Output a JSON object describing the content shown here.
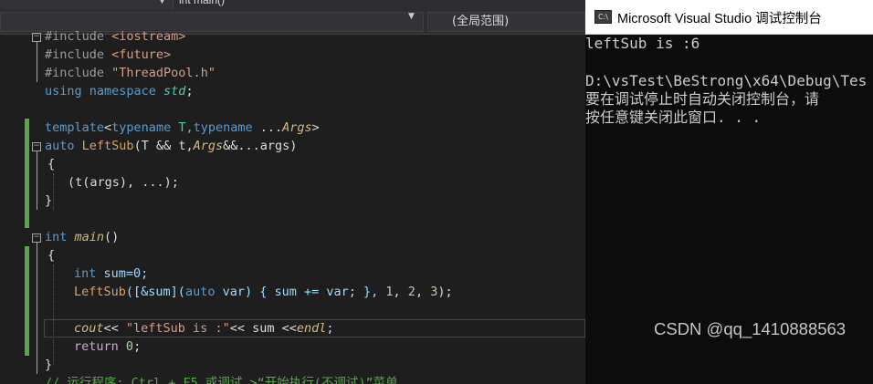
{
  "editor": {
    "top_dropdown": {
      "label": "int main()"
    },
    "scope_dropdown": {
      "label": "(全局范围)"
    },
    "lines": {
      "l1": {
        "a": "#include ",
        "b": "<iostream>"
      },
      "l2": {
        "a": "#include ",
        "b": "<future>"
      },
      "l3": {
        "a": "#include ",
        "b": "\"ThreadPool.h\""
      },
      "l4": {
        "a": "using",
        "b": " namespace ",
        "c": "std",
        "d": ";"
      },
      "l6": {
        "a": "template",
        "b": "<",
        "c": "typename",
        "d": " T,",
        "e": "typename",
        "f": " ...",
        "g": "Args",
        "h": ">"
      },
      "l7": {
        "a": "auto",
        "b": " ",
        "c": "LeftSub",
        "d": "(T && t,",
        "e": "Args",
        "f": "&&...args)"
      },
      "l8": {
        "a": "{"
      },
      "l9": {
        "a": "(t(args), ...);"
      },
      "l10": {
        "a": "}"
      },
      "l12": {
        "a": "int",
        "b": " ",
        "c": "main",
        "d": "()"
      },
      "l13": {
        "a": "{"
      },
      "l14": {
        "a": "int",
        "b": " sum=0;"
      },
      "l15": {
        "a": "LeftSub",
        "b": "([&sum](",
        "c": "auto",
        "d": " var) { sum += var; }, ",
        "e": "1",
        "f": ", ",
        "g": "2",
        "h": ", ",
        "i": "3",
        "j": ");"
      },
      "l17": {
        "a": "cout",
        "b": "<< ",
        "c": "\"leftSub is :\"",
        "d": "<< sum <<",
        "e": "endl",
        "f": ";"
      },
      "l18": {
        "a": "return",
        "b": " ",
        "c": "0",
        "d": ";"
      },
      "l19": {
        "a": "}"
      },
      "l20": {
        "a": "// 运行程序: Ctrl + F5 或调试 >“开始执行(不调试)”菜单"
      }
    }
  },
  "console": {
    "title": "Microsoft Visual Studio 调试控制台",
    "icon_text": "C:\\",
    "output": [
      "leftSub is :6",
      "",
      "D:\\vsTest\\BeStrong\\x64\\Debug\\Tes",
      "要在调试停止时自动关闭控制台，请",
      "按任意键关闭此窗口. . ."
    ]
  },
  "watermark": "CSDN @qq_1410888563",
  "colors": {
    "editor_bg": "#1e1e1e",
    "keyword": "#569cd6",
    "string": "#d69d85",
    "type_italic": "#d7ba7d",
    "comment": "#57a64a",
    "console_bg": "#0c0c0c"
  }
}
